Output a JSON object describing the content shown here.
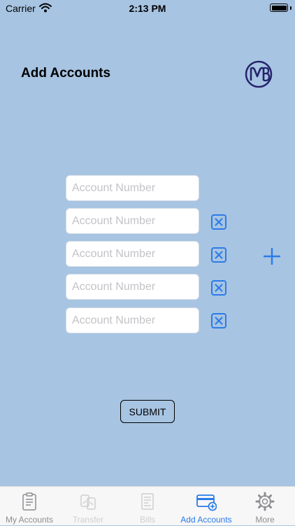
{
  "status_bar": {
    "carrier": "Carrier",
    "time": "2:13 PM"
  },
  "header": {
    "title": "Add Accounts",
    "logo_icon": "mb-logo-icon"
  },
  "form": {
    "fields": [
      {
        "placeholder": "Account Number",
        "value": "",
        "removable": false
      },
      {
        "placeholder": "Account Number",
        "value": "",
        "removable": true
      },
      {
        "placeholder": "Account Number",
        "value": "",
        "removable": true
      },
      {
        "placeholder": "Account Number",
        "value": "",
        "removable": true
      },
      {
        "placeholder": "Account Number",
        "value": "",
        "removable": true
      }
    ],
    "remove_icon": "close-box-icon",
    "add_icon": "plus-icon",
    "submit_label": "SUBMIT"
  },
  "tab_bar": {
    "tabs": [
      {
        "label": "My Accounts",
        "icon": "clipboard-icon",
        "state": "normal"
      },
      {
        "label": "Transfer",
        "icon": "transfer-icon",
        "state": "faded"
      },
      {
        "label": "Bills",
        "icon": "bills-icon",
        "state": "faded"
      },
      {
        "label": "Add Accounts",
        "icon": "add-card-icon",
        "state": "active"
      },
      {
        "label": "More",
        "icon": "gear-icon",
        "state": "normal"
      }
    ]
  },
  "colors": {
    "background": "#a7c4e2",
    "accent": "#2b7be8",
    "logo": "#25246b"
  }
}
